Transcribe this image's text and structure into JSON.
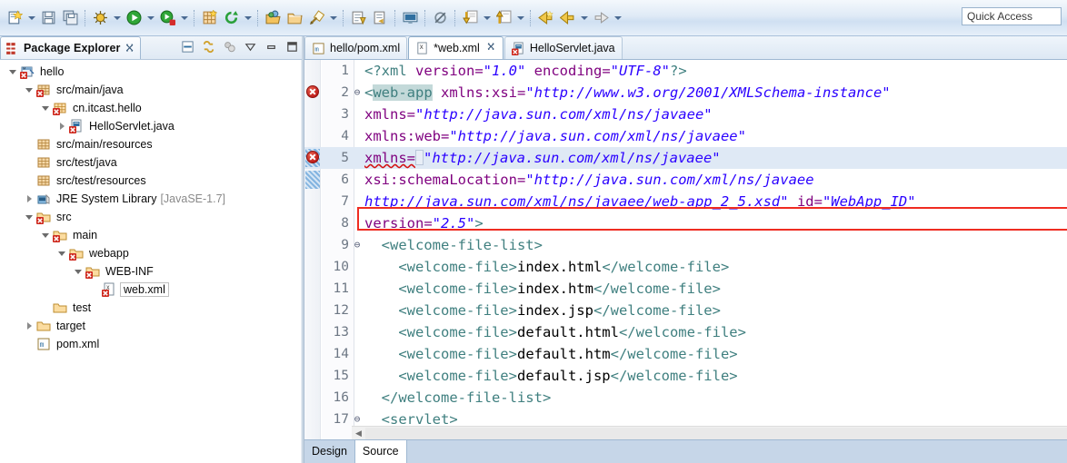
{
  "window": {
    "quick_access_placeholder": "Quick Access"
  },
  "toolbar": {
    "groups": [
      {
        "items": [
          {
            "name": "new-wizard-icon",
            "arrow": true
          },
          {
            "name": "save-icon",
            "arrow": false
          },
          {
            "name": "save-all-icon",
            "arrow": false
          }
        ]
      },
      {
        "items": [
          {
            "name": "debug-icon",
            "arrow": true
          },
          {
            "name": "run-icon",
            "arrow": true
          },
          {
            "name": "run-external-tools-icon",
            "arrow": true
          }
        ]
      },
      {
        "items": [
          {
            "name": "new-java-package-icon",
            "arrow": false
          },
          {
            "name": "refresh-icon",
            "arrow": true
          }
        ]
      },
      {
        "items": [
          {
            "name": "open-type-icon",
            "arrow": false
          },
          {
            "name": "open-task-icon",
            "arrow": false
          },
          {
            "name": "search-icon",
            "arrow": true
          }
        ]
      },
      {
        "items": [
          {
            "name": "next-annotation-icon",
            "arrow": false
          },
          {
            "name": "previous-annotation-icon",
            "arrow": false
          }
        ]
      },
      {
        "items": [
          {
            "name": "console-icon",
            "arrow": false
          }
        ]
      },
      {
        "items": [
          {
            "name": "skip-breakpoints-icon",
            "arrow": false
          }
        ]
      },
      {
        "items": [
          {
            "name": "step-into-icon",
            "arrow": true
          },
          {
            "name": "step-return-icon",
            "arrow": true
          }
        ]
      },
      {
        "items": [
          {
            "name": "back-history-icon",
            "arrow": false
          },
          {
            "name": "previous-edit-icon",
            "arrow": true
          },
          {
            "name": "forward-history-icon",
            "arrow": true
          }
        ]
      }
    ]
  },
  "package_explorer": {
    "tab_label": "Package Explorer",
    "tab_icon": "package-explorer-icon",
    "close_icon": "close-icon",
    "tools": [
      {
        "name": "collapse-all-icon"
      },
      {
        "name": "link-with-editor-icon"
      },
      {
        "name": "focus-on-active-task-icon"
      },
      {
        "name": "view-menu-icon"
      },
      {
        "name": "minimize-icon"
      },
      {
        "name": "maximize-icon"
      }
    ],
    "tree": [
      {
        "label": "hello",
        "indent": 0,
        "twist": "expanded",
        "icon": "project-error-icon",
        "error": true,
        "selected": false,
        "suffix": ""
      },
      {
        "label": "src/main/java",
        "indent": 1,
        "twist": "expanded",
        "icon": "source-folder-error-icon",
        "error": true,
        "selected": false,
        "suffix": ""
      },
      {
        "label": "cn.itcast.hello",
        "indent": 2,
        "twist": "expanded",
        "icon": "package-error-icon",
        "error": true,
        "selected": false,
        "suffix": ""
      },
      {
        "label": "HelloServlet.java",
        "indent": 3,
        "twist": "collapsed",
        "icon": "java-file-error-icon",
        "error": true,
        "selected": false,
        "suffix": ""
      },
      {
        "label": "src/main/resources",
        "indent": 1,
        "twist": "none",
        "icon": "source-folder-icon",
        "error": false,
        "selected": false,
        "suffix": ""
      },
      {
        "label": "src/test/java",
        "indent": 1,
        "twist": "none",
        "icon": "source-folder-icon",
        "error": false,
        "selected": false,
        "suffix": ""
      },
      {
        "label": "src/test/resources",
        "indent": 1,
        "twist": "none",
        "icon": "source-folder-icon",
        "error": false,
        "selected": false,
        "suffix": ""
      },
      {
        "label": "JRE System Library",
        "indent": 1,
        "twist": "collapsed",
        "icon": "jre-library-icon",
        "error": false,
        "selected": false,
        "suffix": "[JavaSE-1.7]"
      },
      {
        "label": "src",
        "indent": 1,
        "twist": "expanded",
        "icon": "folder-error-icon",
        "error": true,
        "selected": false,
        "suffix": ""
      },
      {
        "label": "main",
        "indent": 2,
        "twist": "expanded",
        "icon": "folder-error-icon",
        "error": true,
        "selected": false,
        "suffix": ""
      },
      {
        "label": "webapp",
        "indent": 3,
        "twist": "expanded",
        "icon": "folder-error-icon",
        "error": true,
        "selected": false,
        "suffix": ""
      },
      {
        "label": "WEB-INF",
        "indent": 4,
        "twist": "expanded",
        "icon": "folder-error-icon",
        "error": true,
        "selected": false,
        "suffix": ""
      },
      {
        "label": "web.xml",
        "indent": 5,
        "twist": "none",
        "icon": "xml-file-error-icon",
        "error": true,
        "selected": true,
        "suffix": ""
      },
      {
        "label": "test",
        "indent": 2,
        "twist": "none",
        "icon": "folder-icon",
        "error": false,
        "selected": false,
        "suffix": ""
      },
      {
        "label": "target",
        "indent": 1,
        "twist": "collapsed",
        "icon": "folder-icon",
        "error": false,
        "selected": false,
        "suffix": ""
      },
      {
        "label": "pom.xml",
        "indent": 1,
        "twist": "none",
        "icon": "maven-pom-icon",
        "error": false,
        "selected": false,
        "suffix": ""
      }
    ]
  },
  "editor": {
    "tabs": [
      {
        "label": "hello/pom.xml",
        "icon": "maven-pom-icon",
        "active": false,
        "dirty": false,
        "closable": false
      },
      {
        "label": "*web.xml",
        "icon": "xml-file-icon",
        "active": true,
        "dirty": true,
        "closable": true
      },
      {
        "label": "HelloServlet.java",
        "icon": "java-file-error-icon",
        "active": false,
        "dirty": false,
        "closable": false
      }
    ],
    "bottom_tabs": [
      {
        "label": "Design",
        "active": false
      },
      {
        "label": "Source",
        "active": true
      }
    ],
    "annotation": {
      "kind": "red-rectangle-highlight",
      "around_line": 5,
      "color": "#ef2c21"
    },
    "lines": [
      {
        "number": "1",
        "fold": "",
        "error": false,
        "changed": false,
        "highlight": false,
        "tokens": [
          {
            "t": "<?xml ",
            "c": "s-proc"
          },
          {
            "t": "version=",
            "c": "s-attr"
          },
          {
            "t": "\"1.0\"",
            "c": "s-val"
          },
          {
            "t": " ",
            "c": "s-punct"
          },
          {
            "t": "encoding=",
            "c": "s-attr"
          },
          {
            "t": "\"UTF-8\"",
            "c": "s-val"
          },
          {
            "t": "?>",
            "c": "s-proc"
          }
        ]
      },
      {
        "number": "2",
        "fold": "⊖",
        "error": true,
        "changed": false,
        "highlight": false,
        "tokens": [
          {
            "t": "<",
            "c": "s-tag"
          },
          {
            "t": "web-app",
            "c": "s-hltag"
          },
          {
            "t": " ",
            "c": "s-punct"
          },
          {
            "t": "xmlns:xsi=",
            "c": "s-attr"
          },
          {
            "t": "\"http://www.w3.org/2001/XMLSchema-instance\"",
            "c": "s-val"
          }
        ]
      },
      {
        "number": "3",
        "fold": "",
        "error": false,
        "changed": false,
        "highlight": false,
        "tokens": [
          {
            "t": "xmlns=",
            "c": "s-attr"
          },
          {
            "t": "\"http://java.sun.com/xml/ns/javaee\"",
            "c": "s-val"
          }
        ]
      },
      {
        "number": "4",
        "fold": "",
        "error": false,
        "changed": false,
        "highlight": false,
        "tokens": [
          {
            "t": "xmlns:web=",
            "c": "s-attr"
          },
          {
            "t": "\"http://java.sun.com/xml/ns/javaee\"",
            "c": "s-val"
          }
        ]
      },
      {
        "number": "5",
        "fold": "",
        "error": true,
        "changed": true,
        "highlight": true,
        "tokens": [
          {
            "t": "xmlns=",
            "c": "s-attr squiggle"
          },
          {
            "t": "\"http://java.sun.com/xml/ns/javaee\"",
            "c": "s-val"
          }
        ]
      },
      {
        "number": "6",
        "fold": "",
        "error": false,
        "changed": true,
        "highlight": false,
        "tokens": [
          {
            "t": "xsi:schemaLocation=",
            "c": "s-attr"
          },
          {
            "t": "\"http://java.sun.com/xml/ns/javaee",
            "c": "s-val"
          }
        ]
      },
      {
        "number": "7",
        "fold": "",
        "error": false,
        "changed": false,
        "highlight": false,
        "tokens": [
          {
            "t": "http://java.sun.com/xml/ns/javaee/web-app_2_5.xsd\"",
            "c": "s-val"
          },
          {
            "t": " ",
            "c": "s-punct"
          },
          {
            "t": "id=",
            "c": "s-attr"
          },
          {
            "t": "\"WebApp_ID\"",
            "c": "s-val"
          }
        ]
      },
      {
        "number": "8",
        "fold": "",
        "error": false,
        "changed": false,
        "highlight": false,
        "tokens": [
          {
            "t": "version=",
            "c": "s-attr"
          },
          {
            "t": "\"2.5\"",
            "c": "s-val"
          },
          {
            "t": ">",
            "c": "s-tag"
          }
        ]
      },
      {
        "number": "9",
        "fold": "⊖",
        "error": false,
        "changed": false,
        "highlight": false,
        "tokens": [
          {
            "t": "  <welcome-file-list>",
            "c": "s-tag"
          }
        ]
      },
      {
        "number": "10",
        "fold": "",
        "error": false,
        "changed": false,
        "highlight": false,
        "tokens": [
          {
            "t": "    <welcome-file>",
            "c": "s-tag"
          },
          {
            "t": "index.html",
            "c": "s-text"
          },
          {
            "t": "</welcome-file>",
            "c": "s-tag"
          }
        ]
      },
      {
        "number": "11",
        "fold": "",
        "error": false,
        "changed": false,
        "highlight": false,
        "tokens": [
          {
            "t": "    <welcome-file>",
            "c": "s-tag"
          },
          {
            "t": "index.htm",
            "c": "s-text"
          },
          {
            "t": "</welcome-file>",
            "c": "s-tag"
          }
        ]
      },
      {
        "number": "12",
        "fold": "",
        "error": false,
        "changed": false,
        "highlight": false,
        "tokens": [
          {
            "t": "    <welcome-file>",
            "c": "s-tag"
          },
          {
            "t": "index.jsp",
            "c": "s-text"
          },
          {
            "t": "</welcome-file>",
            "c": "s-tag"
          }
        ]
      },
      {
        "number": "13",
        "fold": "",
        "error": false,
        "changed": false,
        "highlight": false,
        "tokens": [
          {
            "t": "    <welcome-file>",
            "c": "s-tag"
          },
          {
            "t": "default.html",
            "c": "s-text"
          },
          {
            "t": "</welcome-file>",
            "c": "s-tag"
          }
        ]
      },
      {
        "number": "14",
        "fold": "",
        "error": false,
        "changed": false,
        "highlight": false,
        "tokens": [
          {
            "t": "    <welcome-file>",
            "c": "s-tag"
          },
          {
            "t": "default.htm",
            "c": "s-text"
          },
          {
            "t": "</welcome-file>",
            "c": "s-tag"
          }
        ]
      },
      {
        "number": "15",
        "fold": "",
        "error": false,
        "changed": false,
        "highlight": false,
        "tokens": [
          {
            "t": "    <welcome-file>",
            "c": "s-tag"
          },
          {
            "t": "default.jsp",
            "c": "s-text"
          },
          {
            "t": "</welcome-file>",
            "c": "s-tag"
          }
        ]
      },
      {
        "number": "16",
        "fold": "",
        "error": false,
        "changed": false,
        "highlight": false,
        "tokens": [
          {
            "t": "  </welcome-file-list>",
            "c": "s-tag"
          }
        ]
      },
      {
        "number": "17",
        "fold": "⊖",
        "error": false,
        "changed": false,
        "highlight": false,
        "tokens": [
          {
            "t": "  <servlet>",
            "c": "s-tag"
          }
        ]
      }
    ]
  }
}
